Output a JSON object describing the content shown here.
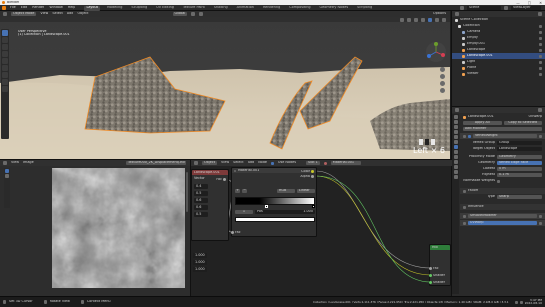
{
  "window": {
    "title": "Blender",
    "controls": [
      "—",
      "□",
      "✕"
    ]
  },
  "topbar": {
    "menus": [
      "File",
      "Edit",
      "Render",
      "Window",
      "Help"
    ],
    "workspaces": [
      "Layout",
      "Modeling",
      "Sculpting",
      "UV Editing",
      "Texture Paint",
      "Shading",
      "Animation",
      "Rendering",
      "Compositing",
      "Geometry Nodes",
      "Scripting"
    ],
    "active_workspace": "Layout",
    "scene": "Scene",
    "view_layer": "ViewLayer"
  },
  "viewport": {
    "mode": "Object Mode",
    "menus": [
      "View",
      "Select",
      "Add",
      "Object"
    ],
    "transform": "Global",
    "options": "Options",
    "info_line1": "User Perspective",
    "info_line2": "(1) Collection | Landscape.001",
    "corner_label": "Left × 6",
    "accent": "#f08a24"
  },
  "outliner": {
    "title": "Scene Collection",
    "items": [
      {
        "name": "Collection",
        "level": 1,
        "color": "#d9d9d9"
      },
      {
        "name": "Camera",
        "level": 2,
        "color": "#8da4c9"
      },
      {
        "name": "Empty",
        "level": 2,
        "color": "#c9c9c9"
      },
      {
        "name": "Empty.001",
        "level": 2,
        "color": "#c9c9c9"
      },
      {
        "name": "Landscape",
        "level": 2,
        "color": "#f0a050"
      },
      {
        "name": "Landscape.001",
        "level": 2,
        "color": "#f0a050",
        "selected": true
      },
      {
        "name": "Light",
        "level": 2,
        "color": "#c9c9c9"
      },
      {
        "name": "Plane",
        "level": 2,
        "color": "#f0a050"
      },
      {
        "name": "Viewer",
        "level": 2,
        "color": "#f0a050"
      }
    ]
  },
  "properties": {
    "object": "Landscape.001",
    "modifier_tab": "UVWarp",
    "apply_label": "Apply All",
    "copy_label": "Copy to Selected",
    "add_modifier": "Add Modifier",
    "modifier_name": "VertexWeight",
    "rows": [
      {
        "label": "Vertex Group",
        "value": "Group"
      },
      {
        "label": "Target Object",
        "value": "Landscape"
      },
      {
        "label": "Proximity Mode",
        "value": "Geometry"
      },
      {
        "label": "Geometry",
        "value": "Vertex  Edge  Face"
      },
      {
        "label": "Lowest",
        "value": "0 m"
      },
      {
        "label": "Highest",
        "value": "0.1 m"
      },
      {
        "label": "Normalize Weights",
        "value": ""
      }
    ],
    "falloff_label": "Falloff",
    "falloff_type_label": "Type",
    "falloff_type": "Sharp",
    "influence_label": "Influence",
    "bottom_mods": [
      "SmoothModifier",
      "UVWarp"
    ]
  },
  "image_editor": {
    "mode": "View",
    "menus": [
      "View",
      "Image"
    ],
    "image_name": "Texture000_2K_DisplacementJ.exr",
    "values": [
      "0.4",
      "0.5",
      "0.6",
      "0.6",
      "0.5",
      "1.000",
      "1.000",
      "1.000"
    ]
  },
  "node_editor": {
    "header": [
      "Object",
      "View",
      "Select",
      "Add",
      "Node",
      "Use Nodes"
    ],
    "slot": "Slot 1",
    "material": "Material.001",
    "texture_node": {
      "title": "Landscape.001",
      "label": "Vector",
      "output": "Fac"
    },
    "colorramp_node": {
      "title": "Material.001",
      "mode": "RGB",
      "interp": "Linear",
      "pos": "1",
      "pos_label": "Pos",
      "pos_value": "1.000",
      "outputs": [
        "Color",
        "Alpha"
      ],
      "input": "Fac"
    },
    "output_node": {
      "title": "Mix",
      "sockets": [
        "Fac",
        "Shader",
        "Shader"
      ]
    }
  },
  "statusbar": {
    "left_items": [
      "Set 3D Cursor",
      "Rotate View",
      "Context Menu"
    ],
    "scene_info": "Collection | Landscape.001 | Verts:1,111,376 | Faces:2,221,950 | Tris:2,221,950 | Objects:1/8 | Memory: 1.40 GiB | VRAM: 2.9/8.0 GiB | 3.3.1",
    "time": "3:47 PM",
    "date": "2022-08-10"
  },
  "colors": {
    "accent": "#f08a24",
    "selection": "#334d80",
    "ramp_black": "#000000",
    "ramp_white": "#ffffff",
    "socket_yellow": "#c7c729",
    "socket_gray": "#a1a1a1",
    "socket_green": "#63c763",
    "node_green": "#2e7d3a"
  }
}
